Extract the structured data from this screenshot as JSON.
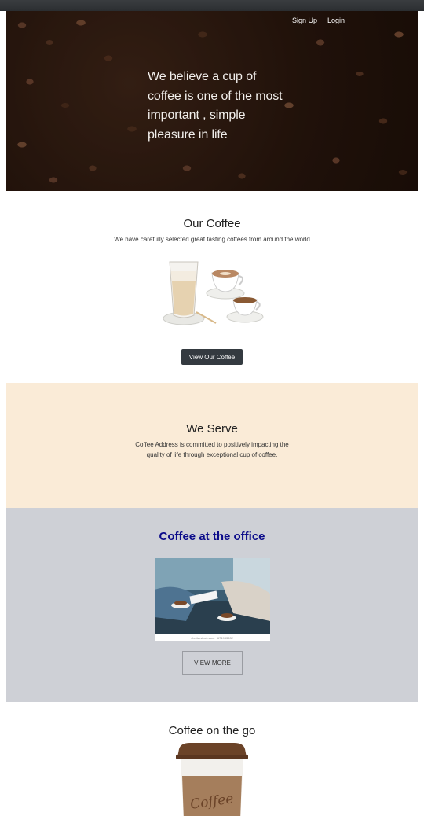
{
  "hero": {
    "nav": {
      "signup": "Sign Up",
      "login": "Login"
    },
    "tagline": "We believe a cup of coffee is one of the most important , simple pleasure in life"
  },
  "our_coffee": {
    "title": "Our Coffee",
    "subtitle": "We have carefully selected great tasting coffees from around the world",
    "button": "View Our Coffee"
  },
  "we_serve": {
    "title": "We Serve",
    "text": "Coffee Address is committed to positively impacting the quality of life through exceptional cup of coffee.",
    "background": "#faebd7"
  },
  "office": {
    "title": "Coffee at the office",
    "image_caption": "shutterstock.com · 671983632",
    "button": "VIEW MORE",
    "title_color": "#0b0b8a",
    "background": "#ced0d6"
  },
  "on_the_go": {
    "title": "Coffee on the go",
    "cup_label": "Coffee"
  },
  "colors": {
    "button_dark": "#343a40"
  }
}
